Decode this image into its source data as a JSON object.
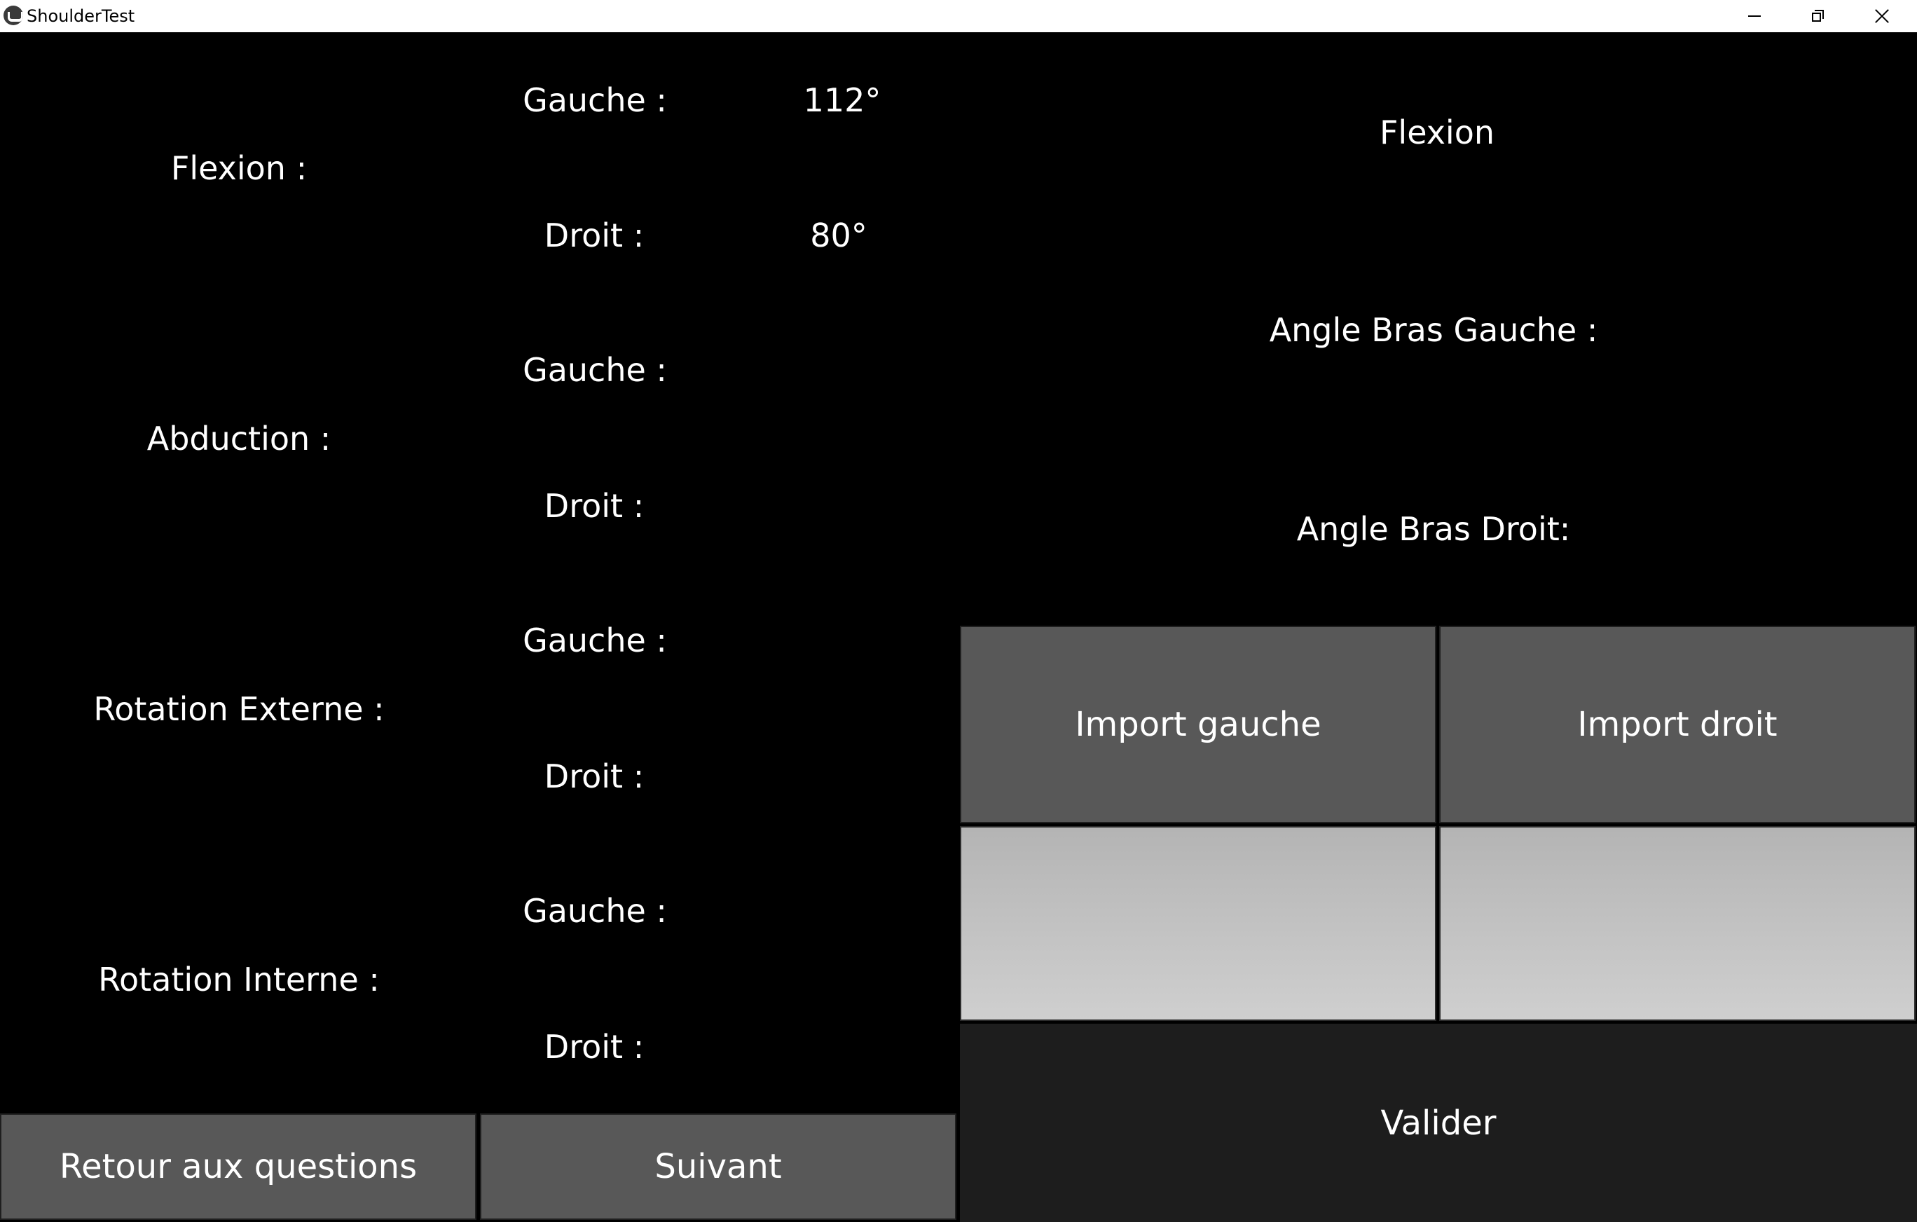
{
  "window": {
    "title": "ShoulderTest",
    "controls": {
      "minimize_icon": "minimize-icon",
      "maximize_icon": "restore-icon",
      "close_icon": "close-icon"
    }
  },
  "measurements": [
    {
      "label": "Flexion :",
      "left_label": "Gauche :",
      "left_value": "112°",
      "right_label": "Droit :",
      "right_value": "80°"
    },
    {
      "label": "Abduction :",
      "left_label": "Gauche :",
      "left_value": "",
      "right_label": "Droit :",
      "right_value": ""
    },
    {
      "label": "Rotation Externe :",
      "left_label": "Gauche :",
      "left_value": "",
      "right_label": "Droit :",
      "right_value": ""
    },
    {
      "label": "Rotation Interne :",
      "left_label": "Gauche :",
      "left_value": "",
      "right_label": "Droit :",
      "right_value": ""
    }
  ],
  "right_panel": {
    "current_movement": "Flexion",
    "angle_left_label": "Angle Bras Gauche :",
    "angle_right_label": "Angle Bras Droit:",
    "import_left_label": "Import gauche",
    "import_right_label": "Import droit",
    "validate_label": "Valider"
  },
  "bottom_buttons": {
    "back_label": "Retour aux questions",
    "next_label": "Suivant"
  },
  "colors": {
    "background": "#000000",
    "button": "#585858",
    "validate": "#1d1d1d",
    "input_panel": "#c0c0c0",
    "text": "#ffffff"
  }
}
